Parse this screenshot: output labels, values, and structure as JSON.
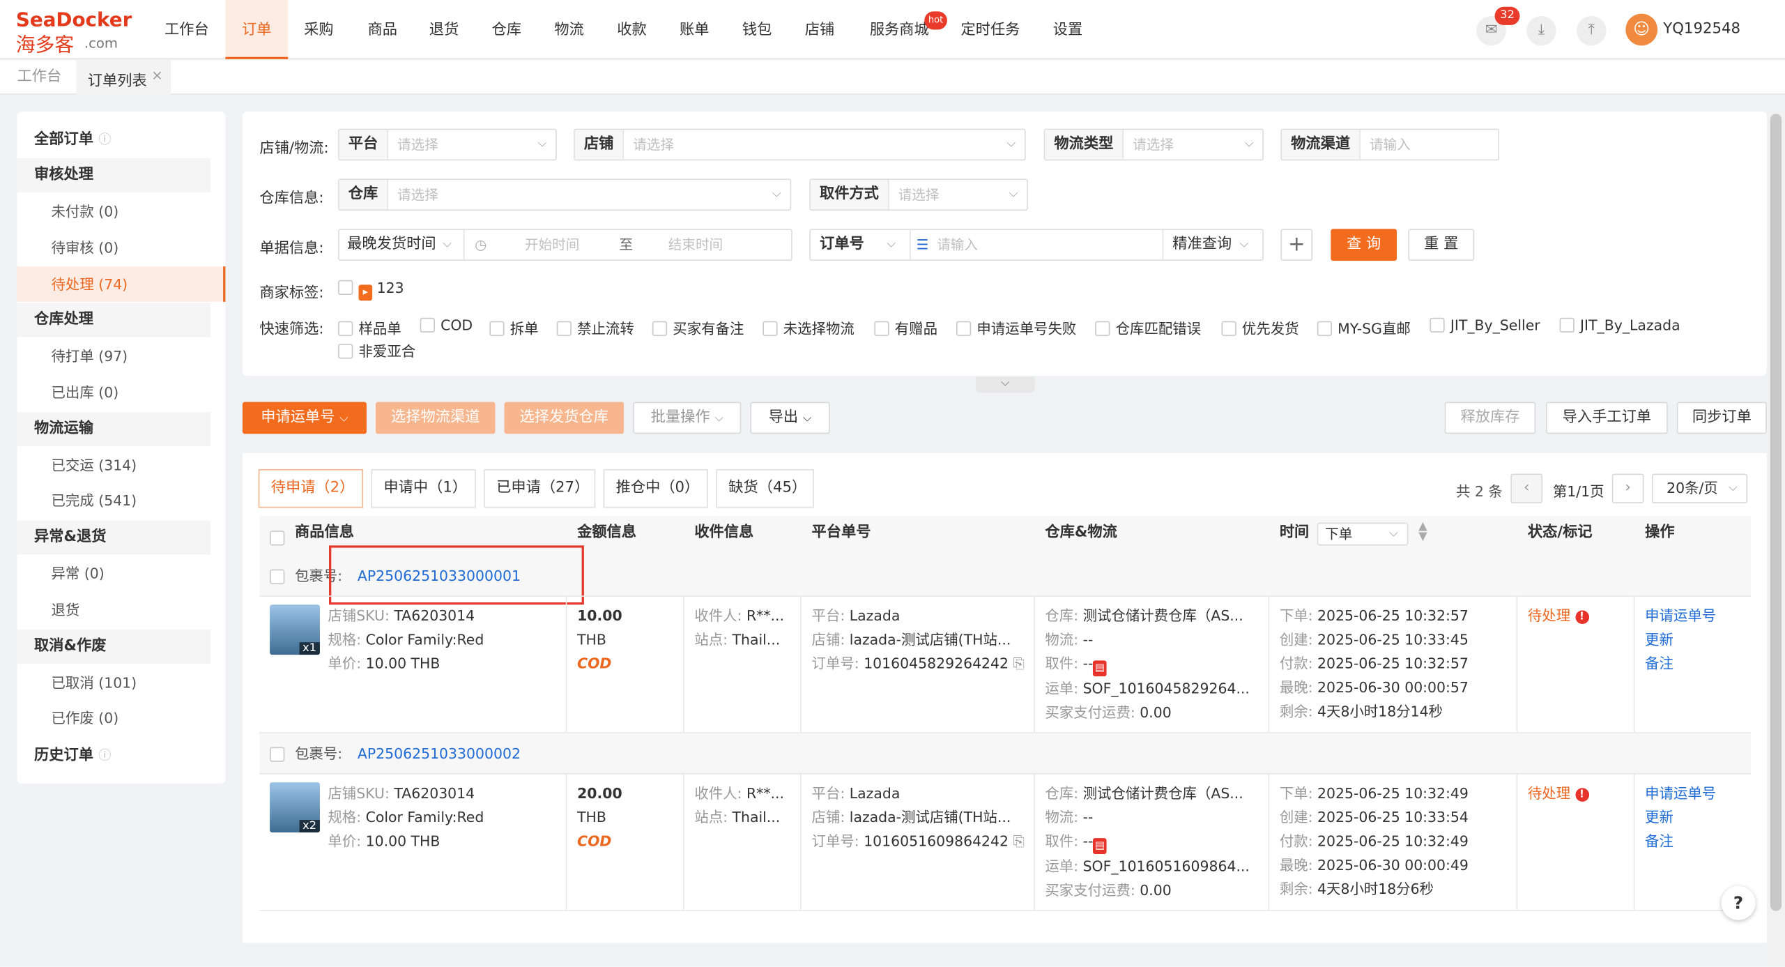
{
  "brand": {
    "en": "SeaDocker",
    "cn": "海多客",
    "com": ".com"
  },
  "nav": [
    "工作台",
    "订单",
    "采购",
    "商品",
    "退货",
    "仓库",
    "物流",
    "收款",
    "账单",
    "钱包",
    "店铺",
    "服务商城",
    "定时任务",
    "设置"
  ],
  "nav_active": "订单",
  "nav_hot_badge": "hot",
  "notify_count": "32",
  "user": {
    "name": "YQ192548",
    "avatar_char": "☺"
  },
  "page_tabs": [
    "工作台",
    "订单列表"
  ],
  "sidebar": {
    "all_orders": "全部订单",
    "groups": [
      {
        "title": "审核处理",
        "items": [
          "未付款 (0)",
          "待审核 (0)",
          "待处理 (74)"
        ]
      },
      {
        "title": "仓库处理",
        "items": [
          "待打单 (97)",
          "已出库 (0)"
        ]
      },
      {
        "title": "物流运输",
        "items": [
          "已交运 (314)",
          "已完成 (541)"
        ]
      },
      {
        "title": "异常&退货",
        "items": [
          "异常 (0)",
          "退货"
        ]
      },
      {
        "title": "取消&作废",
        "items": [
          "已取消 (101)",
          "已作废 (0)"
        ]
      }
    ],
    "history": "历史订单",
    "active_item": "待处理 (74)"
  },
  "filters": {
    "shop_logistics_label": "店铺/物流:",
    "platform": {
      "label": "平台",
      "placeholder": "请选择"
    },
    "shop": {
      "label": "店铺",
      "placeholder": "请选择"
    },
    "logistics_type": {
      "label": "物流类型",
      "placeholder": "请选择"
    },
    "logistics_channel": {
      "label": "物流渠道",
      "placeholder": "请输入"
    },
    "warehouse_info_label": "仓库信息:",
    "warehouse": {
      "label": "仓库",
      "placeholder": "请选择"
    },
    "pickup": {
      "label": "取件方式",
      "placeholder": "请选择"
    },
    "doc_info_label": "单据信息:",
    "time_type": "最晚发货时间",
    "start_placeholder": "开始时间",
    "range_sep": "至",
    "end_placeholder": "结束时间",
    "order_no": "订单号",
    "order_no_placeholder": "请输入",
    "match_mode": "精准查询",
    "query": "查 询",
    "reset": "重 置",
    "merchant_tag_label": "商家标签:",
    "merchant_tag": "123",
    "quick_label": "快速筛选:",
    "quick": [
      "样品单",
      "COD",
      "拆单",
      "禁止流转",
      "买家有备注",
      "未选择物流",
      "有赠品",
      "申请运单号失败",
      "仓库匹配错误",
      "优先发货",
      "MY-SG直邮",
      "JIT_By_Seller",
      "JIT_By_Lazada",
      "非爱亚合"
    ]
  },
  "actions": {
    "apply_waybill": "申请运单号",
    "select_channel": "选择物流渠道",
    "select_warehouse": "选择发货仓库",
    "batch": "批量操作",
    "export": "导出",
    "release_stock": "释放库存",
    "import_manual": "导入手工订单",
    "sync": "同步订单"
  },
  "status_tabs": [
    "待申请（2）",
    "申请中（1）",
    "已申请（27）",
    "推仓中（0）",
    "缺货（45）"
  ],
  "pager": {
    "total": "共 2 条",
    "page": "第1/1页",
    "size": "20条/页"
  },
  "columns": {
    "product": "商品信息",
    "amount": "金额信息",
    "receiver": "收件信息",
    "platform_no": "平台单号",
    "wh_logistics": "仓库&物流",
    "time": "时间",
    "time_sort": "下单",
    "status": "状态/标记",
    "ops": "操作"
  },
  "orders": [
    {
      "pkg_label": "包裹号:",
      "pkg_no": "AP2506251033000001",
      "sku": "TA6203014",
      "spec": "Color Family:Red",
      "unit_price": "10.00 THB",
      "qty": "x1",
      "amount": "10.00",
      "currency": "THB",
      "cod": "COD",
      "receiver": "R**...",
      "site": "Thail...",
      "platform": "Lazada",
      "store": "lazada-测试店铺(TH站...",
      "order_no": "1016045829264242",
      "warehouse": "测试仓储计费仓库（AS...",
      "logistics": "--",
      "pickup": "--",
      "waybill": "SOF_1016045829264...",
      "buyer_fee": "0.00",
      "t_order": "2025-06-25 10:32:57",
      "t_create": "2025-06-25 10:33:45",
      "t_pay": "2025-06-25 10:32:57",
      "t_latest": "2025-06-30 00:00:57",
      "t_left": "4天8小时18分14秒",
      "status": "待处理",
      "ops": [
        "申请运单号",
        "更新",
        "备注"
      ]
    },
    {
      "pkg_label": "包裹号:",
      "pkg_no": "AP2506251033000002",
      "sku": "TA6203014",
      "spec": "Color Family:Red",
      "unit_price": "10.00 THB",
      "qty": "x2",
      "amount": "20.00",
      "currency": "THB",
      "cod": "COD",
      "receiver": "R**...",
      "site": "Thail...",
      "platform": "Lazada",
      "store": "lazada-测试店铺(TH站...",
      "order_no": "1016051609864242",
      "warehouse": "测试仓储计费仓库（AS...",
      "logistics": "--",
      "pickup": "--",
      "waybill": "SOF_1016051609864...",
      "buyer_fee": "0.00",
      "t_order": "2025-06-25 10:32:49",
      "t_create": "2025-06-25 10:33:54",
      "t_pay": "2025-06-25 10:32:49",
      "t_latest": "2025-06-30 00:00:49",
      "t_left": "4天8小时18分6秒",
      "status": "待处理",
      "ops": [
        "申请运单号",
        "更新",
        "备注"
      ]
    }
  ],
  "field_labels": {
    "sku": "店铺SKU:",
    "spec": "规格:",
    "unit_price": "单价:",
    "receiver": "收件人:",
    "site": "站点:",
    "platform": "平台:",
    "store": "店铺:",
    "order_no": "订单号:",
    "warehouse": "仓库:",
    "logistics": "物流:",
    "pickup": "取件:",
    "waybill": "运单:",
    "buyer_fee": "买家支付运费:",
    "t_order": "下单:",
    "t_create": "创建:",
    "t_pay": "付款:",
    "t_latest": "最晚:",
    "t_left": "剩余:"
  },
  "help": "?",
  "colors": {
    "accent": "#ec6820",
    "link": "#1e6bd6",
    "danger": "#e8332a"
  }
}
